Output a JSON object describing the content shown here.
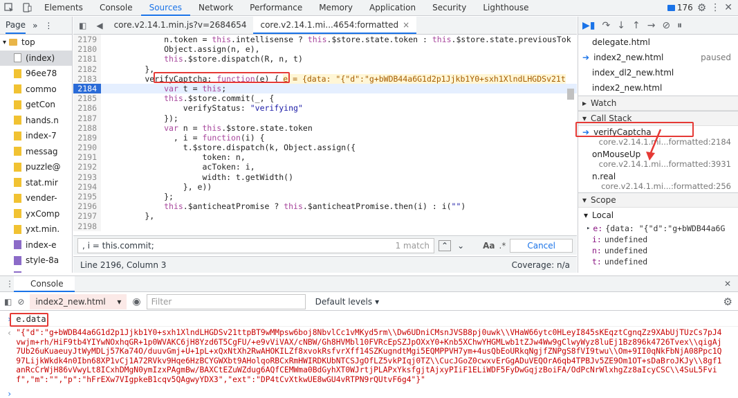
{
  "topbar": {
    "tabs": [
      "Elements",
      "Console",
      "Sources",
      "Network",
      "Performance",
      "Memory",
      "Application",
      "Security",
      "Lighthouse"
    ],
    "selected": "Sources",
    "message_count": "176"
  },
  "navigator": {
    "tab_label": "Page",
    "items": [
      {
        "label": "top",
        "kind": "frame",
        "indent": 1
      },
      {
        "label": "(index)",
        "kind": "blank",
        "indent": 2,
        "selected": true
      },
      {
        "label": "96ee78",
        "kind": "file",
        "indent": 2
      },
      {
        "label": "commo",
        "kind": "file",
        "indent": 2
      },
      {
        "label": "getCon",
        "kind": "file",
        "indent": 2
      },
      {
        "label": "hands.n",
        "kind": "file",
        "indent": 2
      },
      {
        "label": "index-7",
        "kind": "file",
        "indent": 2
      },
      {
        "label": "messag",
        "kind": "file",
        "indent": 2
      },
      {
        "label": "puzzle@",
        "kind": "file",
        "indent": 2
      },
      {
        "label": "stat.mir",
        "kind": "file",
        "indent": 2
      },
      {
        "label": "vender-",
        "kind": "file",
        "indent": 2
      },
      {
        "label": "yxComp",
        "kind": "file",
        "indent": 2
      },
      {
        "label": "yxt.min.",
        "kind": "file",
        "indent": 2
      },
      {
        "label": "index-e",
        "kind": "purple",
        "indent": 2
      },
      {
        "label": "style-8a",
        "kind": "purple",
        "indent": 2
      },
      {
        "label": "yxComp",
        "kind": "purple",
        "indent": 2
      }
    ]
  },
  "editor": {
    "tabs": [
      {
        "label": "core.v2.14.1.min.js?v=2684654",
        "selected": false
      },
      {
        "label": "core.v2.14.1.mi...4654:formatted",
        "selected": true
      }
    ],
    "lines": [
      {
        "n": "2179",
        "text": "            n.token = this.intellisense ? this.$store.state.token : this.$store.state.previousTok"
      },
      {
        "n": "2180",
        "text": "            Object.assign(n, e),"
      },
      {
        "n": "2181",
        "text": "            this.$store.dispatch(R, n, t)"
      },
      {
        "n": "2182",
        "text": "        },"
      },
      {
        "n": "2183",
        "text": "        verifyCaptcha: function(e) {",
        "inline": "e = {data: \"{\"d\":\"g+bWDB44a6G1d2p1Jjkb1Y0+sxh1XlndLHGDSv21t"
      },
      {
        "n": "2184",
        "text": "            var t = this;",
        "exec": true
      },
      {
        "n": "2185",
        "text": "            this.$store.commit(_, {"
      },
      {
        "n": "2186",
        "text": "                verifyStatus: \"verifying\""
      },
      {
        "n": "2187",
        "text": "            });"
      },
      {
        "n": "2188",
        "text": "            var n = this.$store.state.token"
      },
      {
        "n": "2189",
        "text": "              , i = function(i) {"
      },
      {
        "n": "2190",
        "text": "                t.$store.dispatch(k, Object.assign({"
      },
      {
        "n": "2191",
        "text": "                    token: n,"
      },
      {
        "n": "2192",
        "text": "                    acToken: i,"
      },
      {
        "n": "2193",
        "text": "                    width: t.getWidth()"
      },
      {
        "n": "2194",
        "text": "                }, e))"
      },
      {
        "n": "2195",
        "text": "            };"
      },
      {
        "n": "2196",
        "text": "            this.$anticheatPromise ? this.$anticheatPromise.then(i) : i(\"\")"
      },
      {
        "n": "2197",
        "text": "        },"
      },
      {
        "n": "2198",
        "text": "        "
      }
    ],
    "search": {
      "value": ", i = this.commit;",
      "match": "1 match",
      "aa": "Aa",
      "regex": ".*",
      "cancel": "Cancel"
    },
    "status_left": "Line 2196, Column 3",
    "status_right": "Coverage: n/a"
  },
  "debugger": {
    "threads": [
      {
        "label": "delegate.html",
        "status": ""
      },
      {
        "label": "index2_new.html",
        "status": "paused",
        "active": true
      },
      {
        "label": "index_dl2_new.html",
        "status": ""
      },
      {
        "label": "index2_new.html",
        "status": ""
      }
    ],
    "watch_label": "Watch",
    "callstack_label": "Call Stack",
    "frames": [
      {
        "name": "verifyCaptcha",
        "loc": "core.v2.14.1.mi...formatted:2184",
        "active": true
      },
      {
        "name": "onMouseUp",
        "loc": "core.v2.14.1.mi...formatted:3931"
      },
      {
        "name": "n.real",
        "loc": "core.v2.14.1.mi...:formatted:256"
      }
    ],
    "scope_label": "Scope",
    "local_label": "Local",
    "vars": [
      {
        "name": "e:",
        "value": "{data: \"{\"d\":\"g+bWDB44a6G",
        "expand": true
      },
      {
        "name": "i:",
        "value": "undefined"
      },
      {
        "name": "n:",
        "value": "undefined"
      },
      {
        "name": "t:",
        "value": "undefined"
      }
    ]
  },
  "console": {
    "drawer_tab": "Console",
    "context": "index2_new.html",
    "filter_placeholder": "Filter",
    "levels": "Default levels",
    "input": "e.data",
    "output": "\"{\"d\":\"g+bWDB44a6G1d2p1Jjkb1Y0+sxh1XlndLHGDSv21ttpBT9wMMpsw6boj8NbvlCc1vMKyd5rm\\\\Dw6UDniCMsnJVSB8pj0uwk\\\\VHaW66ytc0HLeyI845sKEqztCgnqZz9XAbUjTUzCs7pJ4vwjm+rh/HiF9tb4YIYwNOxhqGR+1p0WVAKC6jH8Yzd6T5CgFU/+e9vViVAX/cNBW/Gh8HVMbl10FVRcEpSZJpOXxY0+Knb5XChwYHGMLwb1tZJw4Ww9gClwyWyz8luEj1Bz896k4726Tvex\\\\qigAj7Ub26uKuaeuyJtWyMDLj57Ka74O/duuvGmj+U+1pL+xQxNtXh2RwAHOKILZf8xvokRsfvrXff14SZKugndtMgi5EQMPPVH7ym+4usQbEoURkqNgjfZNPgS8fVI9twu\\\\Om+9II0qNkFbNjA08Ppc1Q97LijkWkdk4n0Ibn68XP1vCj1A72RVkv9Hqe6HzBCYGWXbt9AHolqoRBCxRmHWIRDKUbNTCSJgOfLZ5vkPIqj0TZ\\\\CucJGoZ0cwxvErGgADuVEQOrA6qb4TPBJv5ZE9Om1OT+sDaBroJKJy\\\\8gf1anRcCrWjH86vVwyLt8ICxhDMgN0ymIzxPAgmBw/BAXCtEZuWZdug6AQfCEMWma0BdGyhXT0WJrtjPLAPxYksfgjtAjxyPIiF1ELiWDF5FyDwGqjzBoiFA/OdPcNrWlxhgZz8aIcyCSC\\\\4SuL5Fvif\",\"m\":\"\",\"p\":\"hFrEXw7VIgpkeB1cqv5QAgwyYDX3\",\"ext\":\"DP4tCvXtkwUE8wGU4vRTPN9rQUtvF6g4\"}\""
  }
}
